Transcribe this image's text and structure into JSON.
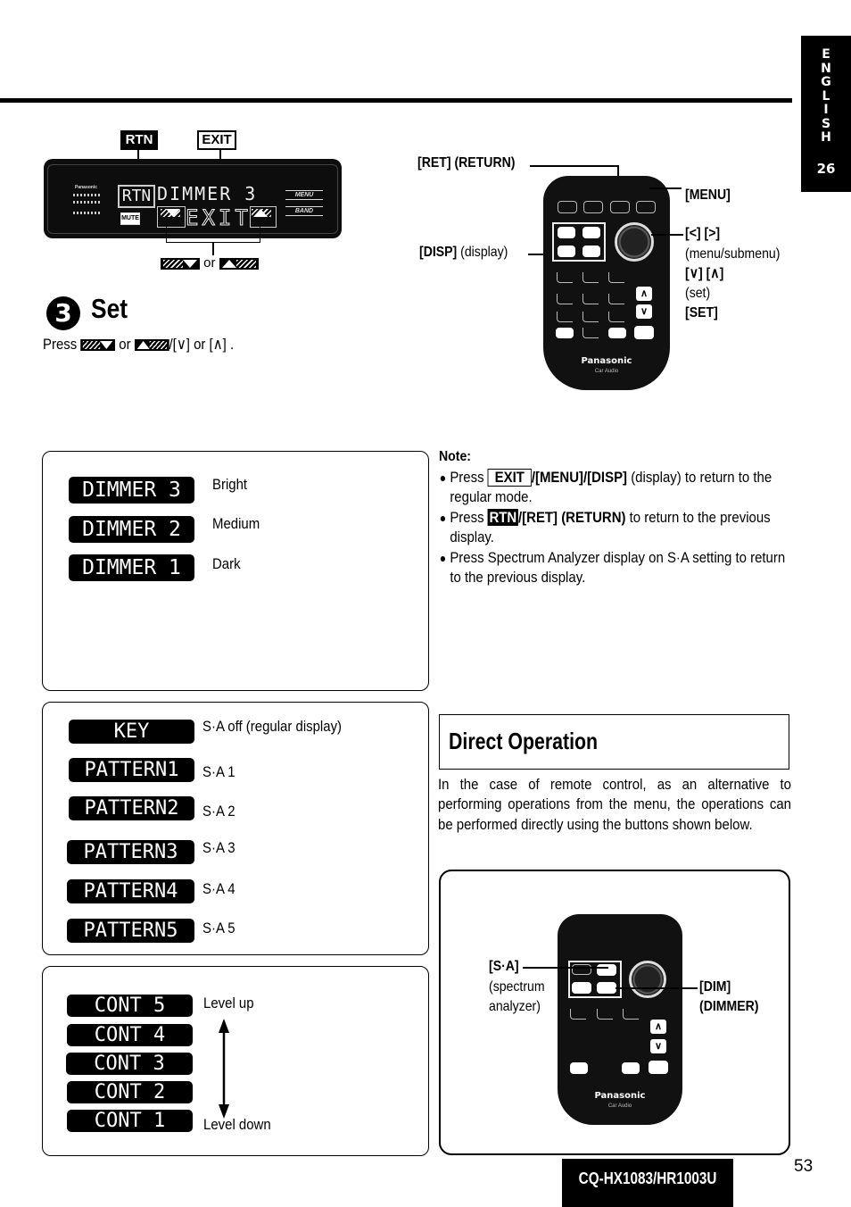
{
  "language_tab": {
    "letters": [
      "E",
      "N",
      "G",
      "L",
      "I",
      "S",
      "H"
    ],
    "section_number": "26"
  },
  "display_figure": {
    "callout_rtn": "RTN",
    "callout_exit": "EXIT",
    "panel": {
      "brand": "Panasonic",
      "rtn_text": "RTN",
      "main_text": "DIMMER 3",
      "exit_text": "EXIT",
      "mute_label": "MUTE",
      "menu_label": "MENU",
      "band_label": "BAND"
    },
    "or_text": "or",
    "down_key_icon": "down-triangle-key-icon",
    "up_key_icon": "up-triangle-key-icon"
  },
  "step": {
    "number": "3",
    "title": "Set",
    "instruction_press": "Press",
    "instruction_or": "or",
    "instruction_tail": "/[∨] or [∧] ."
  },
  "remote_top": {
    "label_ret": "[RET] (RETURN)",
    "label_disp_bold": "[DISP]",
    "label_disp_rest": " (display)",
    "label_menu": "[MENU]",
    "label_arrows_lr": "[<] [>]",
    "label_menu_submenu": "(menu/submenu)",
    "label_arrows_ud": "[∨] [∧]",
    "label_set_paren": "(set)",
    "label_set": "[SET]",
    "brand": "Panasonic",
    "sub_brand": "Car Audio"
  },
  "dimmer_box": {
    "items": [
      {
        "lcd": "DIMMER 3",
        "desc": "Bright"
      },
      {
        "lcd": "DIMMER 2",
        "desc": "Medium"
      },
      {
        "lcd": "DIMMER 1",
        "desc": "Dark"
      }
    ]
  },
  "note": {
    "title": "Note:",
    "items": [
      {
        "pre": "Press ",
        "key": "EXIT",
        "bold": "/[MENU]/[DISP]",
        "post": " (display) to return to the regular mode."
      },
      {
        "pre": "Press ",
        "key": "RTN",
        "bold": "/[RET] (RETURN)",
        "post": " to return to the previous display."
      },
      {
        "text": "Press Spectrum Analyzer display on S·A setting to return to the previous display."
      }
    ]
  },
  "pattern_box": {
    "items": [
      {
        "lcd": "KEY",
        "desc": "S·A off (regular display)"
      },
      {
        "lcd": "PATTERN1",
        "desc": "S·A 1"
      },
      {
        "lcd": "PATTERN2",
        "desc": "S·A 2"
      },
      {
        "lcd": "PATTERN3",
        "desc": "S·A 3"
      },
      {
        "lcd": "PATTERN4",
        "desc": "S·A 4"
      },
      {
        "lcd": "PATTERN5",
        "desc": "S·A 5"
      }
    ]
  },
  "contrast_box": {
    "items": [
      "CONT 5",
      "CONT 4",
      "CONT 3",
      "CONT 2",
      "CONT 1"
    ],
    "level_up": "Level up",
    "level_down": "Level down"
  },
  "direct_operation": {
    "title": "Direct Operation",
    "body": "In the case of remote control, as an alternative to performing operations from the menu, the operations can be performed directly using the buttons shown below.",
    "label_sa": "[S·A]",
    "label_sa_desc1": "(spectrum",
    "label_sa_desc2": "analyzer)",
    "label_dim": "[DIM]",
    "label_dimmer": "(DIMMER)",
    "brand": "Panasonic",
    "sub_brand": "Car Audio"
  },
  "footer": {
    "model": "CQ-HX1083/HR1003U",
    "page_number": "53"
  }
}
